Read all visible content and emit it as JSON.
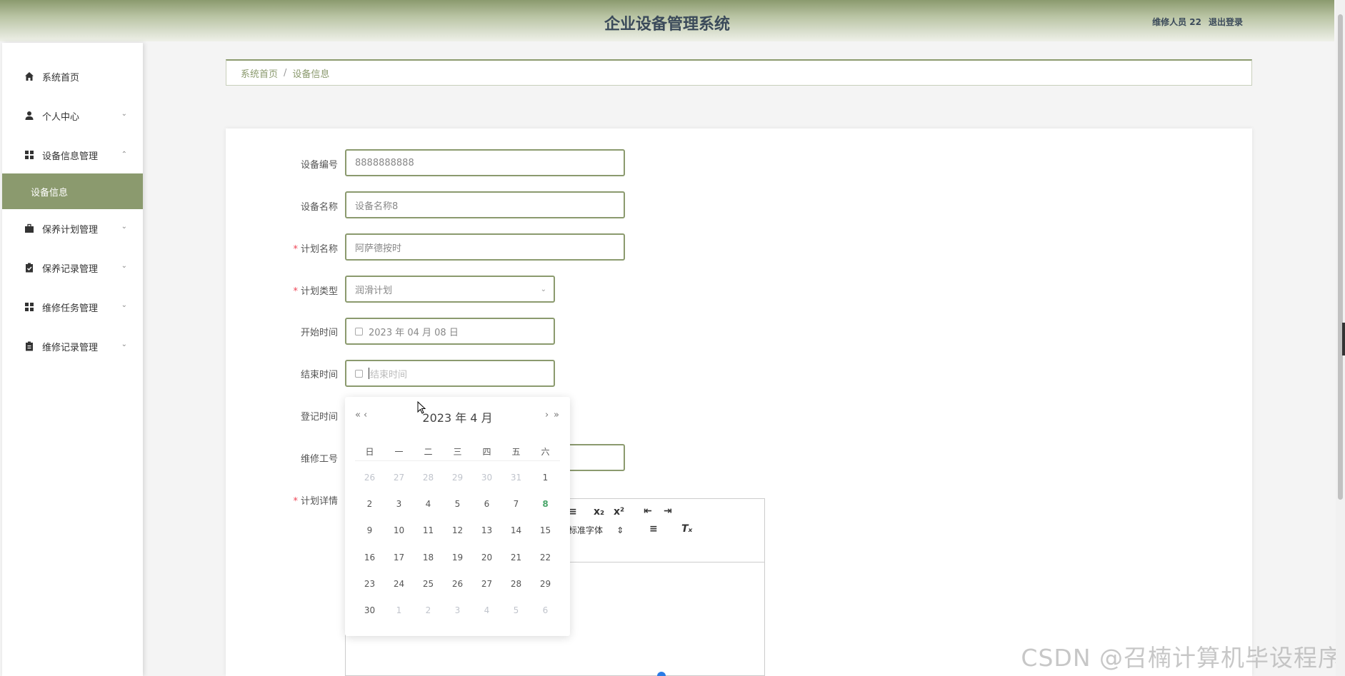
{
  "header": {
    "title": "企业设备管理系统",
    "user": "维修人员 22",
    "logout": "退出登录"
  },
  "sidebar": {
    "items": [
      {
        "label": "系统首页",
        "icon": "home-icon"
      },
      {
        "label": "个人中心",
        "icon": "user-icon",
        "expandable": true
      },
      {
        "label": "设备信息管理",
        "icon": "grid-icon",
        "expanded": true
      },
      {
        "label": "保养计划管理",
        "icon": "briefcase-icon",
        "expandable": true
      },
      {
        "label": "保养记录管理",
        "icon": "clipboard-check-icon",
        "expandable": true
      },
      {
        "label": "维修任务管理",
        "icon": "grid-icon",
        "expandable": true
      },
      {
        "label": "维修记录管理",
        "icon": "clipboard-icon",
        "expandable": true
      }
    ],
    "active_sub": "设备信息"
  },
  "breadcrumb": {
    "home": "系统首页",
    "separator": "/",
    "current": "设备信息"
  },
  "form": {
    "device_no": {
      "label": "设备编号",
      "value": "8888888888"
    },
    "device_name": {
      "label": "设备名称",
      "value": "设备名称8"
    },
    "plan_name": {
      "label": "计划名称",
      "value": "阿萨德按时",
      "required": true
    },
    "plan_type": {
      "label": "计划类型",
      "value": "润滑计划",
      "required": true
    },
    "start_time": {
      "label": "开始时间",
      "value": "2023 年 04 月 08 日"
    },
    "end_time": {
      "label": "结束时间",
      "placeholder": "结束时间"
    },
    "reg_time": {
      "label": "登记时间"
    },
    "worker_no": {
      "label": "维修工号"
    },
    "plan_detail": {
      "label": "计划详情",
      "required": true,
      "font_select": "标准字体"
    }
  },
  "datepicker": {
    "title": "2023 年  4 月",
    "prev_year": "«",
    "prev_month": "‹",
    "next_month": "›",
    "next_year": "»",
    "weekdays": [
      "日",
      "一",
      "二",
      "三",
      "四",
      "五",
      "六"
    ],
    "days": [
      {
        "d": "26",
        "m": true
      },
      {
        "d": "27",
        "m": true
      },
      {
        "d": "28",
        "m": true
      },
      {
        "d": "29",
        "m": true
      },
      {
        "d": "30",
        "m": true
      },
      {
        "d": "31",
        "m": true
      },
      {
        "d": "1"
      },
      {
        "d": "2"
      },
      {
        "d": "3"
      },
      {
        "d": "4"
      },
      {
        "d": "5"
      },
      {
        "d": "6"
      },
      {
        "d": "7"
      },
      {
        "d": "8",
        "today": true
      },
      {
        "d": "9"
      },
      {
        "d": "10"
      },
      {
        "d": "11"
      },
      {
        "d": "12"
      },
      {
        "d": "13"
      },
      {
        "d": "14"
      },
      {
        "d": "15"
      },
      {
        "d": "16"
      },
      {
        "d": "17"
      },
      {
        "d": "18"
      },
      {
        "d": "19"
      },
      {
        "d": "20"
      },
      {
        "d": "21"
      },
      {
        "d": "22"
      },
      {
        "d": "23"
      },
      {
        "d": "24"
      },
      {
        "d": "25"
      },
      {
        "d": "26"
      },
      {
        "d": "27"
      },
      {
        "d": "28"
      },
      {
        "d": "29"
      },
      {
        "d": "30"
      },
      {
        "d": "1",
        "m": true
      },
      {
        "d": "2",
        "m": true
      },
      {
        "d": "3",
        "m": true
      },
      {
        "d": "4",
        "m": true
      },
      {
        "d": "5",
        "m": true
      },
      {
        "d": "6",
        "m": true
      }
    ]
  },
  "watermark": "CSDN @召楠计算机毕设程序",
  "colors": {
    "accent": "#8b9a6e",
    "today": "#4aa66a",
    "required": "#e45"
  }
}
